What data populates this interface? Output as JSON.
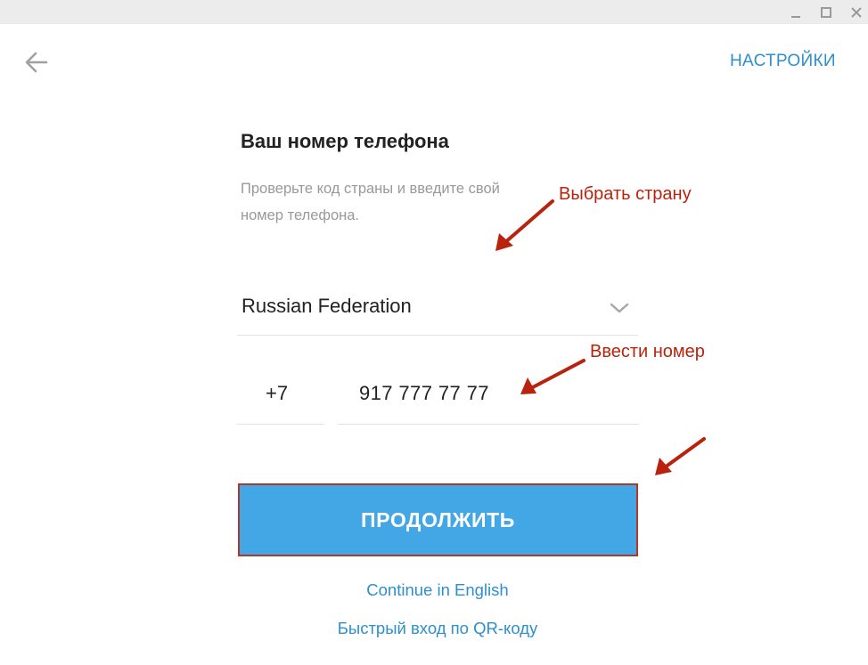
{
  "window": {
    "controls": [
      "minimize-icon",
      "maximize-icon",
      "close-icon"
    ]
  },
  "header": {
    "back_icon": "arrow-left-icon",
    "settings_label": "НАСТРОЙКИ"
  },
  "form": {
    "title": "Ваш номер телефона",
    "hint": "Проверьте код страны и введите свой номер телефона.",
    "country": {
      "value": "Russian Federation",
      "icon": "chevron-down-icon"
    },
    "country_code": "+7",
    "phone_number": "917 777 77 77",
    "continue_label": "ПРОДОЛЖИТЬ",
    "continue_english_label": "Continue in English",
    "qr_login_label": "Быстрый вход по QR-коду"
  },
  "annotations": {
    "choose_country": "Выбрать страну",
    "enter_number": "Ввести номер"
  },
  "colors": {
    "accent": "#43a7e5",
    "link": "#2e8fcc",
    "annotation": "#b9230d",
    "button_outline": "#b1372a"
  }
}
